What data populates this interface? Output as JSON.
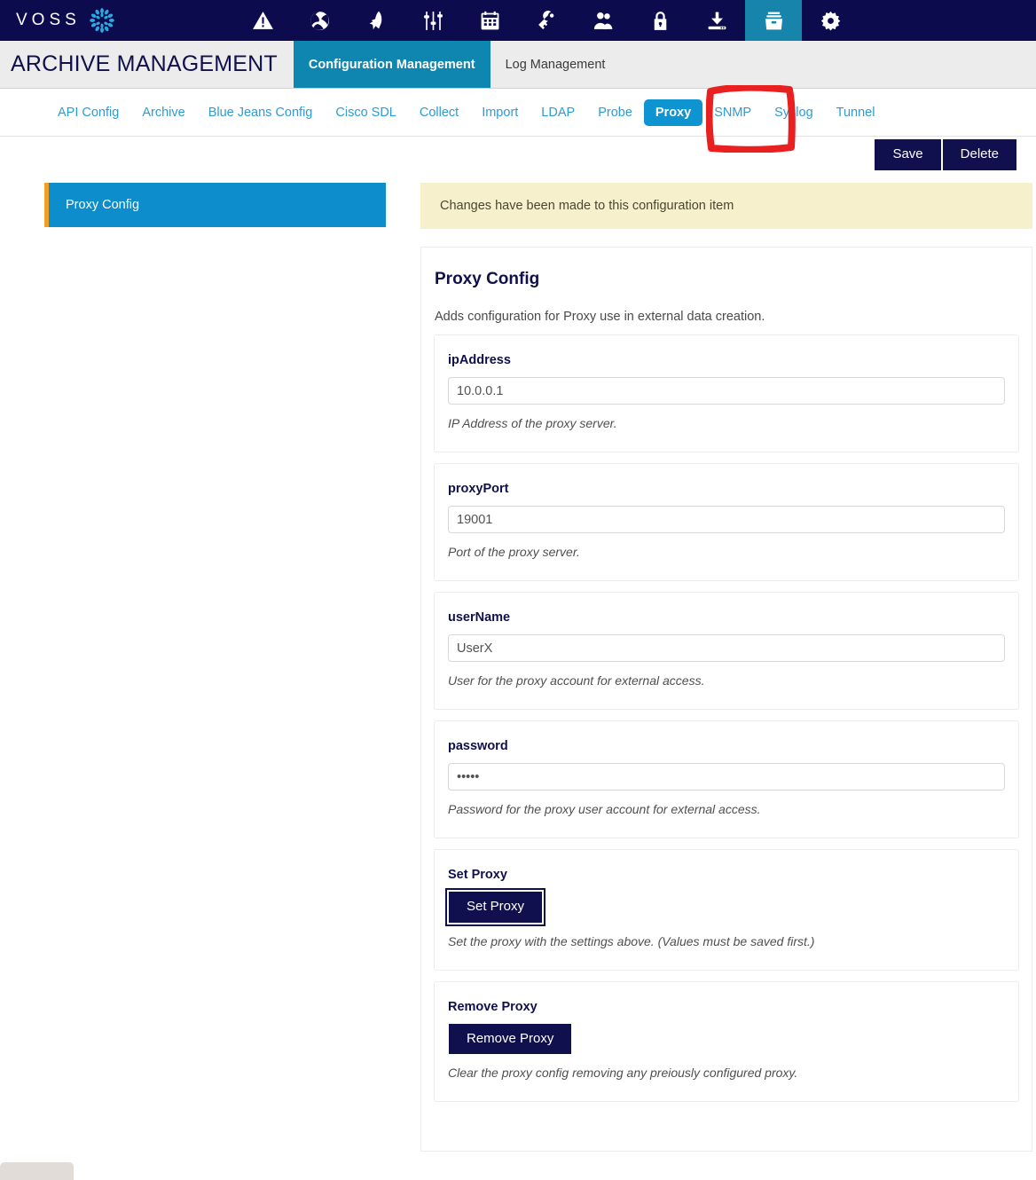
{
  "topbar": {
    "brand_word": "VOSS",
    "brand_logo_icon": "voss-flower-logo",
    "icons": [
      {
        "name": "warning-icon",
        "label": "Alerts"
      },
      {
        "name": "globe-icon",
        "label": "Global"
      },
      {
        "name": "rocket-icon",
        "label": "Launch"
      },
      {
        "name": "sliders-icon",
        "label": "Settings Sliders"
      },
      {
        "name": "calendar-icon",
        "label": "Scheduling"
      },
      {
        "name": "key-icon",
        "label": "Credentials"
      },
      {
        "name": "users-icon",
        "label": "Users"
      },
      {
        "name": "lock-icon",
        "label": "Security"
      },
      {
        "name": "download-icon",
        "label": "Downloads"
      },
      {
        "name": "archive-box-icon",
        "label": "Archive"
      },
      {
        "name": "gear-icon",
        "label": "Settings"
      }
    ],
    "active_icon_index": 9
  },
  "titlebar": {
    "app_title": "ARCHIVE MANAGEMENT",
    "tabs": [
      {
        "label": "Configuration Management",
        "active": true
      },
      {
        "label": "Log Management",
        "active": false
      }
    ]
  },
  "subtabs": {
    "items": [
      {
        "label": "API Config",
        "active": false
      },
      {
        "label": "Archive",
        "active": false
      },
      {
        "label": "Blue Jeans Config",
        "active": false
      },
      {
        "label": "Cisco SDL",
        "active": false
      },
      {
        "label": "Collect",
        "active": false
      },
      {
        "label": "Import",
        "active": false
      },
      {
        "label": "LDAP",
        "active": false
      },
      {
        "label": "Probe",
        "active": false
      },
      {
        "label": "Proxy",
        "active": true
      },
      {
        "label": "SNMP",
        "active": false
      },
      {
        "label": "Syslog",
        "active": false
      },
      {
        "label": "Tunnel",
        "active": false
      }
    ],
    "annotation_color": "#e8201f",
    "annotated_item": "Proxy"
  },
  "actions": {
    "save_label": "Save",
    "delete_label": "Delete"
  },
  "sidebar": {
    "items": [
      {
        "label": "Proxy Config",
        "active": true
      }
    ],
    "accent_color": "#f0a020",
    "active_color": "#0d8dcc"
  },
  "alert": {
    "message": "Changes have been made to this configuration item",
    "background": "#f6f0cc"
  },
  "main": {
    "title": "Proxy Config",
    "description": "Adds configuration for Proxy use in external data creation.",
    "fields": [
      {
        "key": "ipAddress",
        "label": "ipAddress",
        "type": "text",
        "value": "10.0.0.1",
        "placeholder": "",
        "help": "IP Address of the proxy server."
      },
      {
        "key": "proxyPort",
        "label": "proxyPort",
        "type": "text",
        "value": "19001",
        "placeholder": "",
        "help": "Port of the proxy server."
      },
      {
        "key": "userName",
        "label": "userName",
        "type": "text",
        "value": "UserX",
        "placeholder": "",
        "help": "User for the proxy account for external access."
      },
      {
        "key": "password",
        "label": "password",
        "type": "password",
        "value": "•••••",
        "placeholder": "",
        "help": "Password for the proxy user account for external access."
      }
    ],
    "action_fields": [
      {
        "key": "setProxy",
        "label": "Set Proxy",
        "button_label": "Set Proxy",
        "focused": true,
        "help": "Set the proxy with the settings above. (Values must be saved first.)"
      },
      {
        "key": "removeProxy",
        "label": "Remove Proxy",
        "button_label": "Remove Proxy",
        "focused": false,
        "help": "Clear the proxy config removing any preiously configured proxy."
      }
    ]
  }
}
